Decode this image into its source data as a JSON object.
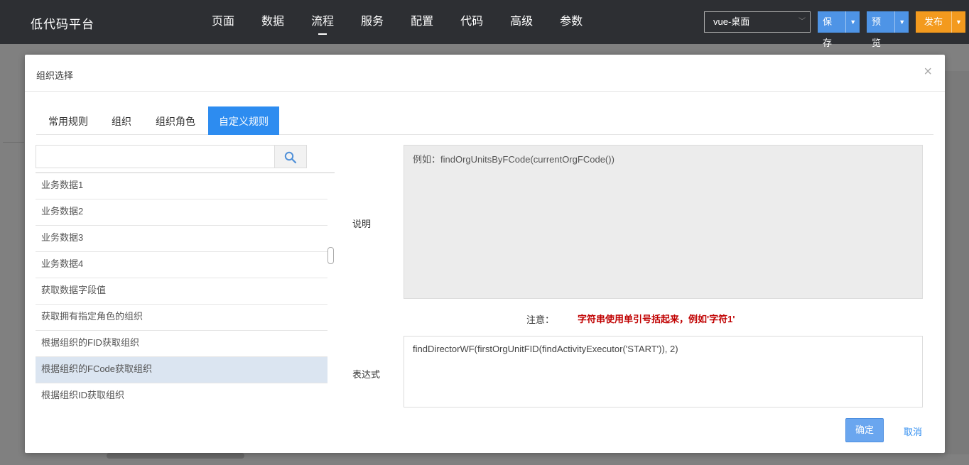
{
  "app": {
    "title": "低代码平台"
  },
  "nav": {
    "items": [
      "页面",
      "数据",
      "流程",
      "服务",
      "配置",
      "代码",
      "高级",
      "参数"
    ],
    "active_index": 2
  },
  "env_select": {
    "value": "vue-桌面"
  },
  "actions": {
    "save": "保存",
    "preview": "预览",
    "publish": "发布"
  },
  "colors": {
    "primary": "#2d8cf0",
    "publish": "#f39a1e",
    "warning_text": "#c00000",
    "selected_row": "#dbe5f1"
  },
  "dialog": {
    "title": "组织选择",
    "tabs": [
      "常用规则",
      "组织",
      "组织角色",
      "自定义规则"
    ],
    "active_tab": 3,
    "search": {
      "value": "",
      "placeholder": ""
    },
    "list": [
      "业务数据1",
      "业务数据2",
      "业务数据3",
      "业务数据4",
      "获取数据字段值",
      "获取拥有指定角色的组织",
      "根据组织的FID获取组织",
      "根据组织的FCode获取组织",
      "根据组织ID获取组织"
    ],
    "selected_index": 7,
    "desc_label": "说明",
    "desc_text": "例如：findOrgUnitsByFCode(currentOrgFCode())",
    "note_label": "注意：",
    "note_text": "字符串使用单引号括起来，例如'字符1'",
    "expr_label": "表达式",
    "expr_text": "findDirectorWF(firstOrgUnitFID(findActivityExecutor('START')), 2)",
    "ok": "确定",
    "cancel": "取消"
  }
}
